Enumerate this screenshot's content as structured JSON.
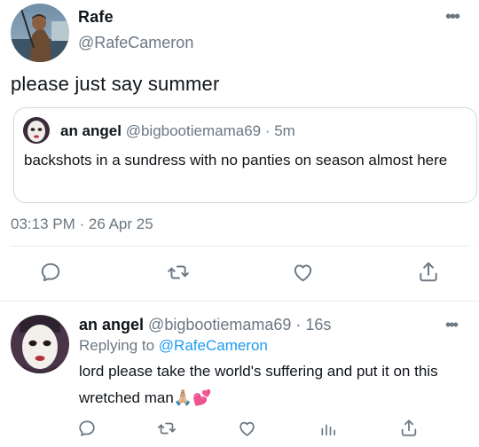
{
  "tweet": {
    "author_name": "Rafe",
    "author_handle": "@RafeCameron",
    "text": "please just say summer",
    "timestamp": "03:13 PM · 26 Apr 25",
    "more_icon": "more-horizontal-icon"
  },
  "quoted_tweet": {
    "author_name": "an angel",
    "author_meta": "@bigbootiemama69 · 5m",
    "text": "backshots in a sundress with no panties on season almost here"
  },
  "actions": {
    "reply_icon": "reply-icon",
    "retweet_icon": "retweet-icon",
    "like_icon": "like-icon",
    "share_icon": "share-icon",
    "views_icon": "views-icon"
  },
  "reply": {
    "author_name": "an angel",
    "author_meta": "@bigbootiemama69 · 16s",
    "replying_to_prefix": "Replying to",
    "replying_to_handle": "@RafeCameron",
    "text": "lord please take the world's suffering and put it on this wretched man🙏🏼💕"
  },
  "colors": {
    "text": "#0f1419",
    "muted": "#6b7782",
    "link": "#1d9bf0",
    "border": "#cfd9de"
  }
}
